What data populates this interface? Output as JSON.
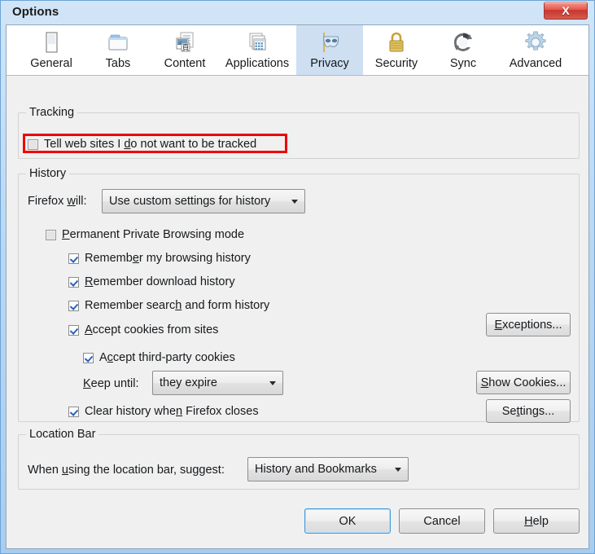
{
  "window": {
    "title": "Options",
    "close_label": "X"
  },
  "tabs": [
    {
      "label": "General",
      "icon": "browser-window-icon",
      "selected": false
    },
    {
      "label": "Tabs",
      "icon": "folder-tabs-icon",
      "selected": false
    },
    {
      "label": "Content",
      "icon": "documents-image-icon",
      "selected": false
    },
    {
      "label": "Applications",
      "icon": "app-windows-icon",
      "selected": false
    },
    {
      "label": "Privacy",
      "icon": "mask-icon",
      "selected": true
    },
    {
      "label": "Security",
      "icon": "padlock-icon",
      "selected": false
    },
    {
      "label": "Sync",
      "icon": "sync-arrows-icon",
      "selected": false
    },
    {
      "label": "Advanced",
      "icon": "gear-icon",
      "selected": false
    }
  ],
  "tracking": {
    "group_title": "Tracking",
    "do_not_track": {
      "before": "Tell web sites I ",
      "accesskey": "d",
      "after": "o not want to be tracked",
      "checked": false
    },
    "highlight_color": "#f00000"
  },
  "history": {
    "group_title": "History",
    "firefox_will_label": {
      "before": "Firefox ",
      "accesskey": "w",
      "after": "ill:"
    },
    "firefox_will_value": "Use custom settings for history",
    "permanent_private": {
      "before": "",
      "accesskey": "P",
      "after": "ermanent Private Browsing mode",
      "checked": false
    },
    "remember_browsing": {
      "before": "Rememb",
      "accesskey": "e",
      "after": "r my browsing history",
      "checked": true
    },
    "remember_download": {
      "before": "",
      "accesskey": "R",
      "after": "emember download history",
      "checked": true
    },
    "remember_search": {
      "before": "Remember searc",
      "accesskey": "h",
      "after": " and form history",
      "checked": true
    },
    "accept_cookies": {
      "before": "",
      "accesskey": "A",
      "after": "ccept cookies from sites",
      "checked": true
    },
    "accept_thirdparty": {
      "before": "A",
      "accesskey": "c",
      "after": "cept third-party cookies",
      "checked": true
    },
    "keep_until_label": {
      "before": "",
      "accesskey": "K",
      "after": "eep until:"
    },
    "keep_until_value": "they expire",
    "clear_history": {
      "before": "Clear history whe",
      "accesskey": "n",
      "after": " Firefox closes",
      "checked": true
    },
    "exceptions_button": {
      "before": "",
      "accesskey": "E",
      "after": "xceptions..."
    },
    "show_cookies_button": {
      "before": "",
      "accesskey": "S",
      "after": "how Cookies..."
    },
    "settings_button": {
      "before": "Se",
      "accesskey": "t",
      "after": "tings..."
    }
  },
  "location_bar": {
    "group_title": "Location Bar",
    "suggest_label": {
      "before": "When ",
      "accesskey": "u",
      "after": "sing the location bar, suggest:"
    },
    "suggest_value": "History and Bookmarks"
  },
  "footer": {
    "ok": {
      "before": "OK",
      "accesskey": "",
      "after": ""
    },
    "cancel": {
      "before": "Cancel",
      "accesskey": "",
      "after": ""
    },
    "help": {
      "before": "",
      "accesskey": "H",
      "after": "elp"
    }
  }
}
